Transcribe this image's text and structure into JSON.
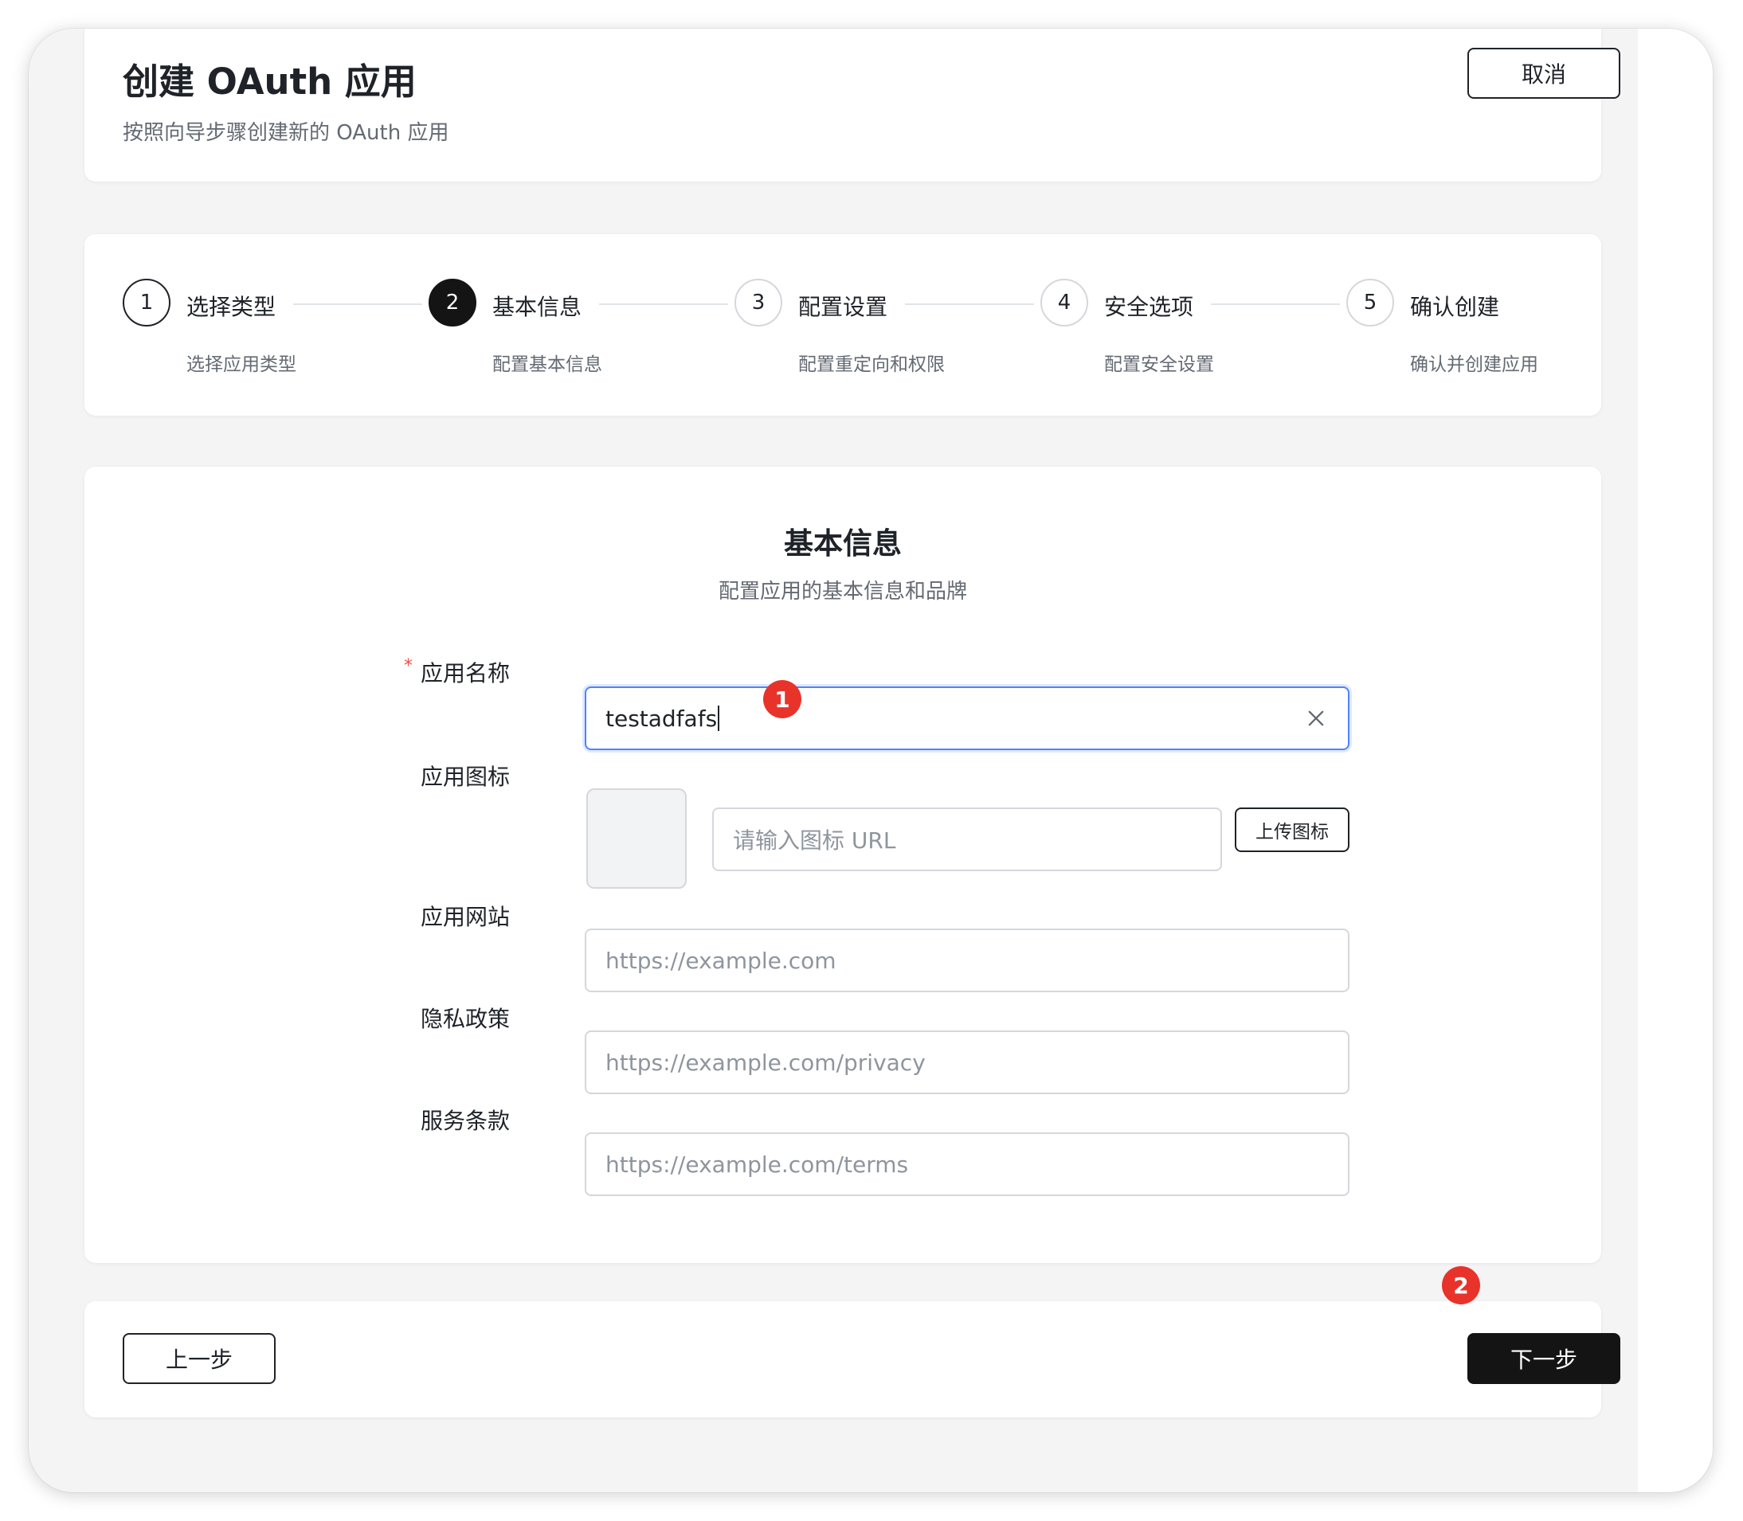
{
  "header": {
    "title": "创建 OAuth 应用",
    "subtitle": "按照向导步骤创建新的 OAuth 应用",
    "cancel_label": "取消"
  },
  "steps": [
    {
      "number": "1",
      "title": "选择类型",
      "description": "选择应用类型",
      "state": "done"
    },
    {
      "number": "2",
      "title": "基本信息",
      "description": "配置基本信息",
      "state": "active"
    },
    {
      "number": "3",
      "title": "配置设置",
      "description": "配置重定向和权限",
      "state": "todo"
    },
    {
      "number": "4",
      "title": "安全选项",
      "description": "配置安全设置",
      "state": "todo"
    },
    {
      "number": "5",
      "title": "确认创建",
      "description": "确认并创建应用",
      "state": "todo"
    }
  ],
  "form": {
    "title": "基本信息",
    "subtitle": "配置应用的基本信息和品牌",
    "required_mark": "*",
    "app_name": {
      "label": "应用名称",
      "value": "testadfafs"
    },
    "app_icon": {
      "label": "应用图标",
      "placeholder": "请输入图标 URL",
      "upload_label": "上传图标"
    },
    "app_website": {
      "label": "应用网站",
      "placeholder": "https://example.com"
    },
    "privacy_policy": {
      "label": "隐私政策",
      "placeholder": "https://example.com/privacy"
    },
    "terms_of_service": {
      "label": "服务条款",
      "placeholder": "https://example.com/terms"
    }
  },
  "footer": {
    "prev_label": "上一步",
    "next_label": "下一步"
  },
  "annotations": [
    "1",
    "2"
  ],
  "colors": {
    "primary_dark": "#141414",
    "focus_border": "#4e83fd",
    "badge_red": "#e8332b",
    "required_red": "#f54a45"
  }
}
